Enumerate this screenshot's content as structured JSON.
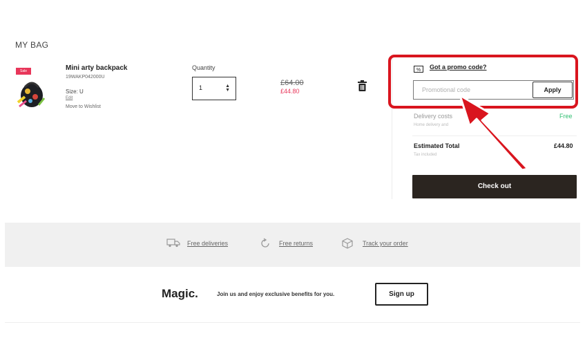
{
  "bag": {
    "title": "MY BAG"
  },
  "product": {
    "badge": "Sale",
    "name": "Mini arty backpack",
    "sku": "19WAKP042000U",
    "size": "Size: U",
    "edit_label": "Edit",
    "wishlist_label": "Move to Wishlist",
    "quantity_label": "Quantity",
    "quantity_value": "1",
    "price_old": "£64.00",
    "price_new": "£44.80",
    "remove_icon": "trash-icon"
  },
  "summary": {
    "promo_link": "Got a promo code?",
    "promo_icon": "percent-ticket-icon",
    "promo_placeholder": "Promotional code",
    "apply_label": "Apply",
    "delivery_label": "Delivery costs",
    "delivery_value": "Free",
    "delivery_sub": "Home delivery and",
    "total_label": "Estimated Total",
    "total_value": "£44.80",
    "total_sub": "Tax included",
    "checkout_label": "Check out"
  },
  "benefits": [
    {
      "label": "Free deliveries",
      "icon": "truck-icon"
    },
    {
      "label": "Free returns",
      "icon": "return-icon"
    },
    {
      "label": "Track your order",
      "icon": "package-icon"
    }
  ],
  "newsletter": {
    "brand": "Magic.",
    "text": "Join us and enjoy exclusive benefits for you.",
    "signup_label": "Sign up"
  },
  "colors": {
    "accent_red": "#d9151e",
    "sale_pink": "#e8365a",
    "free_green": "#2fbf71",
    "checkout_dark": "#2b2520"
  }
}
